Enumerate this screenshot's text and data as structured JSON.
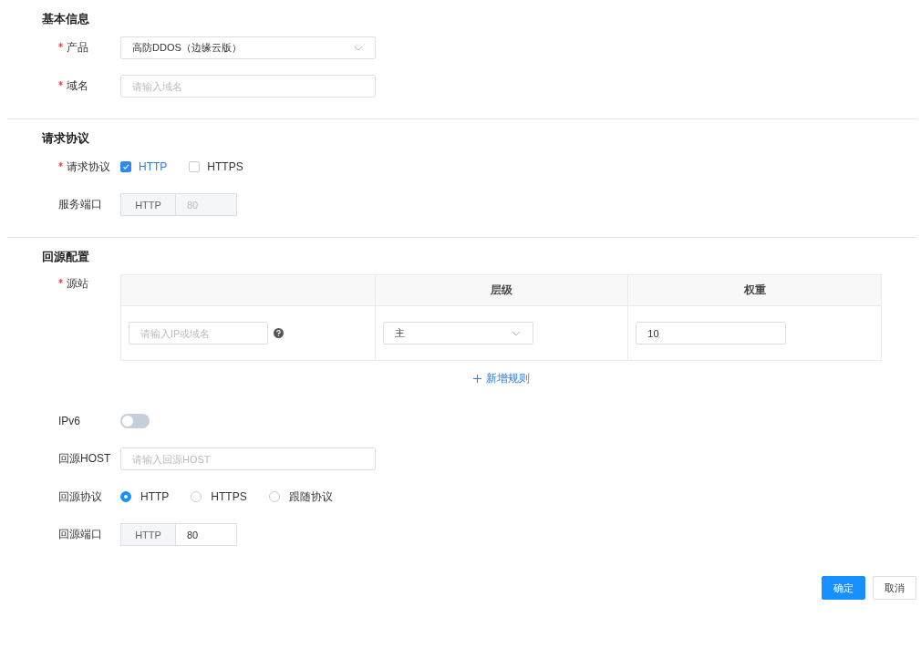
{
  "sections": [
    {
      "title": "基本信息",
      "fields": [
        {
          "kind": "select",
          "label": "产品",
          "required": true,
          "value": "高防DDOS（边缘云版）"
        },
        {
          "kind": "input",
          "label": "域名",
          "required": true,
          "placeholder": "请输入域名"
        }
      ]
    },
    {
      "title": "请求协议",
      "fields": [
        {
          "kind": "checkboxes",
          "label": "请求协议",
          "required": true,
          "options": [
            {
              "label": "HTTP",
              "checked": true
            },
            {
              "label": "HTTPS",
              "checked": false
            }
          ]
        },
        {
          "kind": "port",
          "label": "服务端口",
          "required": false,
          "addon": "HTTP",
          "value": "80",
          "disabled": true
        }
      ]
    },
    {
      "title": "回源配置",
      "fields": [
        {
          "kind": "table",
          "label": "源站",
          "required": true,
          "columns": [
            "",
            "层级",
            "权重"
          ],
          "rows": [
            {
              "address_placeholder": "请输入IP或域名",
              "level": "主",
              "weight": "10"
            }
          ],
          "add_link": "新增规则"
        },
        {
          "kind": "switch",
          "label": "IPv6",
          "required": false,
          "on": false
        },
        {
          "kind": "input",
          "label": "回源HOST",
          "required": false,
          "placeholder": "请输入回源HOST"
        },
        {
          "kind": "radios",
          "label": "回源协议",
          "required": false,
          "options": [
            {
              "label": "HTTP",
              "selected": true
            },
            {
              "label": "HTTPS",
              "selected": false
            },
            {
              "label": "跟随协议",
              "selected": false
            }
          ]
        },
        {
          "kind": "port",
          "label": "回源端口",
          "required": false,
          "addon": "HTTP",
          "value": "80",
          "disabled": false
        }
      ]
    }
  ],
  "buttons": [
    {
      "label": "确定",
      "primary": true
    },
    {
      "label": "取消",
      "primary": false
    }
  ]
}
